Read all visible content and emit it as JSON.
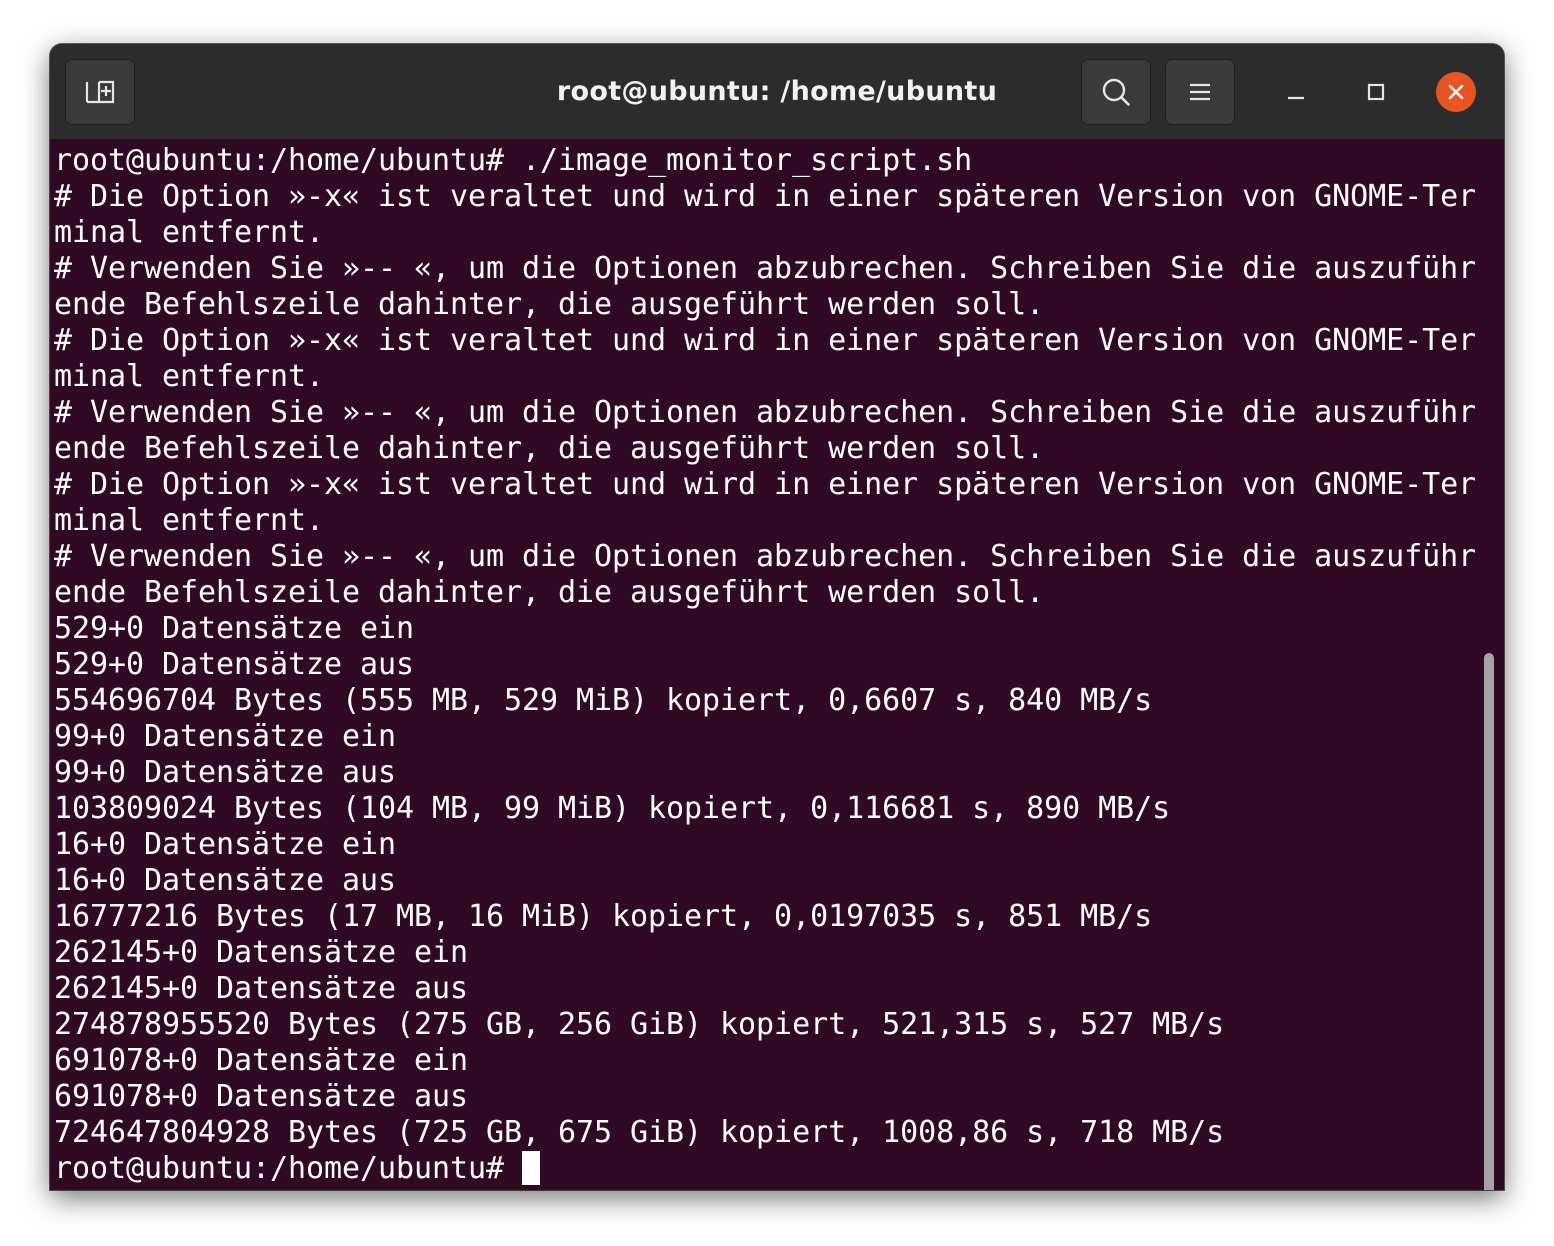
{
  "window": {
    "title": "root@ubuntu: /home/ubuntu"
  },
  "titlebar": {
    "new_tab_icon": "new-tab-icon",
    "search_icon": "search-icon",
    "menu_icon": "hamburger-menu-icon",
    "minimize_icon": "minimize-icon",
    "maximize_icon": "maximize-icon",
    "close_icon": "close-icon",
    "close_color": "#e95420"
  },
  "terminal": {
    "background": "#300a24",
    "foreground": "#ffffff",
    "lines": [
      "root@ubuntu:/home/ubuntu# ./image_monitor_script.sh",
      "# Die Option »-x« ist veraltet und wird in einer späteren Version von GNOME-Ter",
      "minal entfernt.",
      "# Verwenden Sie »-- «, um die Optionen abzubrechen. Schreiben Sie die auszuführ",
      "ende Befehlszeile dahinter, die ausgeführt werden soll.",
      "# Die Option »-x« ist veraltet und wird in einer späteren Version von GNOME-Ter",
      "minal entfernt.",
      "# Verwenden Sie »-- «, um die Optionen abzubrechen. Schreiben Sie die auszuführ",
      "ende Befehlszeile dahinter, die ausgeführt werden soll.",
      "# Die Option »-x« ist veraltet und wird in einer späteren Version von GNOME-Ter",
      "minal entfernt.",
      "# Verwenden Sie »-- «, um die Optionen abzubrechen. Schreiben Sie die auszuführ",
      "ende Befehlszeile dahinter, die ausgeführt werden soll.",
      "529+0 Datensätze ein",
      "529+0 Datensätze aus",
      "554696704 Bytes (555 MB, 529 MiB) kopiert, 0,6607 s, 840 MB/s",
      "99+0 Datensätze ein",
      "99+0 Datensätze aus",
      "103809024 Bytes (104 MB, 99 MiB) kopiert, 0,116681 s, 890 MB/s",
      "16+0 Datensätze ein",
      "16+0 Datensätze aus",
      "16777216 Bytes (17 MB, 16 MiB) kopiert, 0,0197035 s, 851 MB/s",
      "262145+0 Datensätze ein",
      "262145+0 Datensätze aus",
      "274878955520 Bytes (275 GB, 256 GiB) kopiert, 521,315 s, 527 MB/s",
      "691078+0 Datensätze ein",
      "691078+0 Datensätze aus",
      "724647804928 Bytes (725 GB, 675 GiB) kopiert, 1008,86 s, 718 MB/s"
    ],
    "prompt": "root@ubuntu:/home/ubuntu# "
  }
}
